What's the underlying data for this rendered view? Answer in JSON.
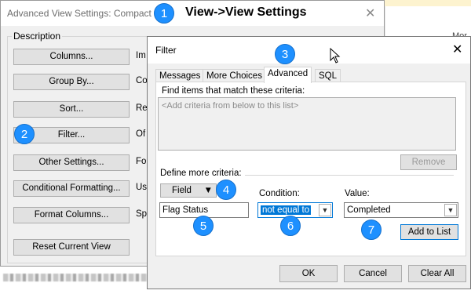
{
  "advanced_dialog": {
    "title": "Advanced View Settings: Compact",
    "group_label": "Description",
    "buttons": [
      {
        "label": "Columns...",
        "desc": "Im"
      },
      {
        "label": "Group By...",
        "desc": "Co"
      },
      {
        "label": "Sort...",
        "desc": "Re"
      },
      {
        "label": "Filter...",
        "desc": "Of"
      },
      {
        "label": "Other Settings...",
        "desc": "Fo"
      },
      {
        "label": "Conditional Formatting...",
        "desc": "Us"
      },
      {
        "label": "Format Columns...",
        "desc": "Sp"
      }
    ],
    "reset_label": "Reset Current View"
  },
  "background": {
    "right_text": "Mor"
  },
  "filter_dialog": {
    "title": "Filter",
    "tabs": [
      "Messages",
      "More Choices",
      "Advanced",
      "SQL"
    ],
    "active_tab": "Advanced",
    "find_label": "Find items that match these criteria:",
    "criteria_placeholder": "<Add criteria from below to this list>",
    "remove_label": "Remove",
    "define_label": "Define more criteria:",
    "field_label": "Field",
    "field_value": "Flag Status",
    "condition_label": "Condition:",
    "condition_value": "not equal to",
    "value_label": "Value:",
    "value_value": "Completed",
    "add_label": "Add to List",
    "ok_label": "OK",
    "cancel_label": "Cancel",
    "clear_label": "Clear All"
  },
  "callouts": {
    "caption": "View->View Settings",
    "numbers": [
      "1",
      "2",
      "3",
      "4",
      "5",
      "6",
      "7"
    ]
  },
  "colors": {
    "badge": "#1e90ff",
    "selection": "#0078d7"
  }
}
